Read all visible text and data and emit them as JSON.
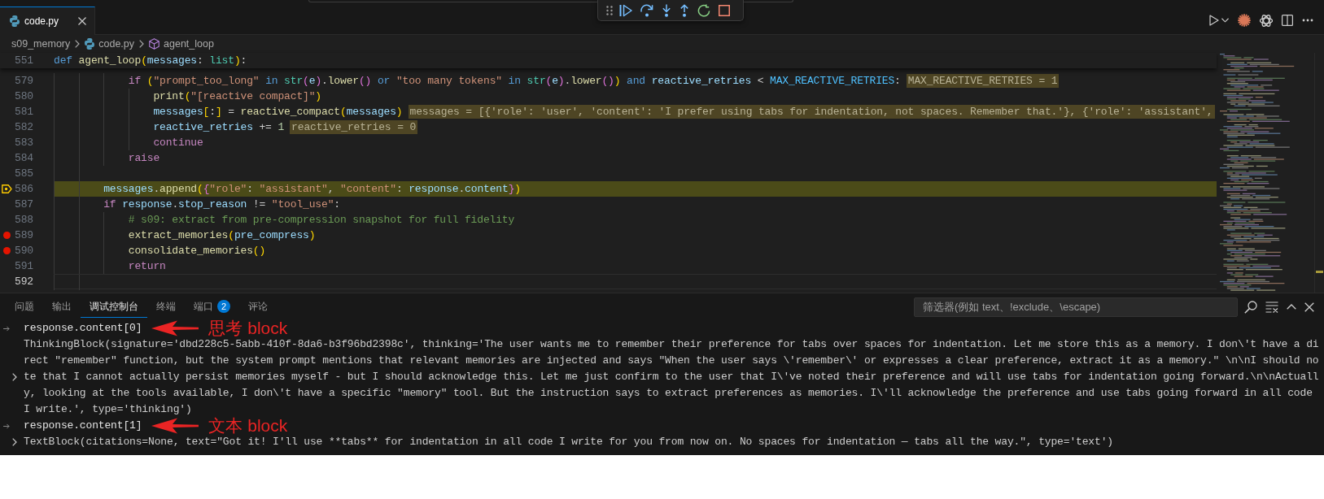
{
  "tabs": [
    {
      "label": "code.py",
      "selected": true
    }
  ],
  "breadcrumb": [
    {
      "label": "s09_memory",
      "kind": "folder"
    },
    {
      "label": "code.py",
      "kind": "file"
    },
    {
      "label": "agent_loop",
      "kind": "symbol"
    }
  ],
  "editor": {
    "sticky_line": {
      "number": "551",
      "code": [
        {
          "text": "def ",
          "kind": "keyword"
        },
        {
          "text": "agent_loop",
          "kind": "function"
        },
        {
          "text": "(",
          "kind": "bracket1"
        },
        {
          "text": "messages",
          "kind": "variable"
        },
        {
          "text": ": ",
          "kind": "plain"
        },
        {
          "text": "list",
          "kind": "type"
        },
        {
          "text": ")",
          "kind": "bracket1"
        },
        {
          "text": ":",
          "kind": "plain"
        }
      ]
    },
    "lines": [
      {
        "number": "579",
        "code": [
          {
            "text": "            if ",
            "kind": "control"
          },
          {
            "text": "(",
            "kind": "bracket1"
          },
          {
            "text": "\"prompt_too_long\"",
            "kind": "string"
          },
          {
            "text": " in ",
            "kind": "keyword"
          },
          {
            "text": "str",
            "kind": "type"
          },
          {
            "text": "(",
            "kind": "bracket2"
          },
          {
            "text": "e",
            "kind": "variable"
          },
          {
            "text": ")",
            "kind": "bracket2"
          },
          {
            "text": ".",
            "kind": "plain"
          },
          {
            "text": "lower",
            "kind": "function"
          },
          {
            "text": "()",
            "kind": "bracket2"
          },
          {
            "text": " or ",
            "kind": "keyword"
          },
          {
            "text": "\"too many tokens\"",
            "kind": "string"
          },
          {
            "text": " in ",
            "kind": "keyword"
          },
          {
            "text": "str",
            "kind": "type"
          },
          {
            "text": "(",
            "kind": "bracket2"
          },
          {
            "text": "e",
            "kind": "variable"
          },
          {
            "text": ")",
            "kind": "bracket2"
          },
          {
            "text": ".",
            "kind": "plain"
          },
          {
            "text": "lower",
            "kind": "function"
          },
          {
            "text": "()",
            "kind": "bracket2"
          },
          {
            "text": ")",
            "kind": "bracket1"
          },
          {
            "text": " and ",
            "kind": "keyword"
          },
          {
            "text": "reactive_retries",
            "kind": "variable"
          },
          {
            "text": " < ",
            "kind": "plain"
          },
          {
            "text": "MAX_REACTIVE_RETRIES",
            "kind": "constant"
          },
          {
            "text": ":",
            "kind": "plain"
          }
        ],
        "inline_value": "MAX_REACTIVE_RETRIES = 1",
        "breakpoint": false,
        "paused": false,
        "cursor": false
      },
      {
        "number": "580",
        "code": [
          {
            "text": "                print",
            "kind": "function"
          },
          {
            "text": "(",
            "kind": "bracket1"
          },
          {
            "text": "\"[reactive compact]\"",
            "kind": "string"
          },
          {
            "text": ")",
            "kind": "bracket1"
          }
        ],
        "breakpoint": false,
        "paused": false,
        "cursor": false
      },
      {
        "number": "581",
        "code": [
          {
            "text": "                messages",
            "kind": "variable"
          },
          {
            "text": "[",
            "kind": "bracket1"
          },
          {
            "text": ":",
            "kind": "plain"
          },
          {
            "text": "]",
            "kind": "bracket1"
          },
          {
            "text": " = ",
            "kind": "plain"
          },
          {
            "text": "reactive_compact",
            "kind": "function"
          },
          {
            "text": "(",
            "kind": "bracket1"
          },
          {
            "text": "messages",
            "kind": "variable"
          },
          {
            "text": ")",
            "kind": "bracket1"
          }
        ],
        "inline_value": "messages = [{'role': 'user', 'content': 'I prefer using tabs for indentation, not spaces. Remember that.'}, {'role': 'assistant',",
        "breakpoint": false,
        "paused": false,
        "cursor": false
      },
      {
        "number": "582",
        "code": [
          {
            "text": "                reactive_retries",
            "kind": "variable"
          },
          {
            "text": " += ",
            "kind": "plain"
          },
          {
            "text": "1",
            "kind": "number"
          }
        ],
        "inline_value": "reactive_retries = 0",
        "breakpoint": false,
        "paused": false,
        "cursor": false
      },
      {
        "number": "583",
        "code": [
          {
            "text": "                continue",
            "kind": "control"
          }
        ],
        "breakpoint": false,
        "paused": false,
        "cursor": false
      },
      {
        "number": "584",
        "code": [
          {
            "text": "            raise",
            "kind": "control"
          }
        ],
        "breakpoint": false,
        "paused": false,
        "cursor": false
      },
      {
        "number": "585",
        "breakpoint": false,
        "paused": false,
        "cursor": false
      },
      {
        "number": "586",
        "code": [
          {
            "text": "        messages",
            "kind": "variable"
          },
          {
            "text": ".",
            "kind": "plain"
          },
          {
            "text": "append",
            "kind": "function"
          },
          {
            "text": "(",
            "kind": "bracket1"
          },
          {
            "text": "{",
            "kind": "bracket2"
          },
          {
            "text": "\"role\"",
            "kind": "string"
          },
          {
            "text": ": ",
            "kind": "plain"
          },
          {
            "text": "\"assistant\"",
            "kind": "string"
          },
          {
            "text": ", ",
            "kind": "plain"
          },
          {
            "text": "\"content\"",
            "kind": "string"
          },
          {
            "text": ": ",
            "kind": "plain"
          },
          {
            "text": "response",
            "kind": "variable"
          },
          {
            "text": ".",
            "kind": "plain"
          },
          {
            "text": "content",
            "kind": "variable"
          },
          {
            "text": "}",
            "kind": "bracket2"
          },
          {
            "text": ")",
            "kind": "bracket1"
          }
        ],
        "breakpoint": false,
        "paused": true,
        "cursor": false
      },
      {
        "number": "587",
        "code": [
          {
            "text": "        if ",
            "kind": "control"
          },
          {
            "text": "response",
            "kind": "variable"
          },
          {
            "text": ".",
            "kind": "plain"
          },
          {
            "text": "stop_reason",
            "kind": "variable"
          },
          {
            "text": " != ",
            "kind": "plain"
          },
          {
            "text": "\"tool_use\"",
            "kind": "string"
          },
          {
            "text": ":",
            "kind": "plain"
          }
        ],
        "breakpoint": false,
        "paused": false,
        "cursor": false
      },
      {
        "number": "588",
        "code": [
          {
            "text": "            # s09: extract from pre-compression snapshot for full fidelity",
            "kind": "comment"
          }
        ],
        "breakpoint": false,
        "paused": false,
        "cursor": false
      },
      {
        "number": "589",
        "code": [
          {
            "text": "            extract_memories",
            "kind": "function"
          },
          {
            "text": "(",
            "kind": "bracket1"
          },
          {
            "text": "pre_compress",
            "kind": "variable"
          },
          {
            "text": ")",
            "kind": "bracket1"
          }
        ],
        "breakpoint": true,
        "paused": false,
        "cursor": false
      },
      {
        "number": "590",
        "code": [
          {
            "text": "            consolidate_memories",
            "kind": "function"
          },
          {
            "text": "()",
            "kind": "bracket1"
          }
        ],
        "breakpoint": true,
        "paused": false,
        "cursor": false
      },
      {
        "number": "591",
        "code": [
          {
            "text": "            return",
            "kind": "control"
          }
        ],
        "breakpoint": false,
        "paused": false,
        "cursor": false
      },
      {
        "number": "592",
        "breakpoint": false,
        "paused": false,
        "cursor": true
      }
    ]
  },
  "panel": {
    "tabs": [
      {
        "label": "问题",
        "selected": false
      },
      {
        "label": "输出",
        "selected": false
      },
      {
        "label": "调试控制台",
        "selected": true
      },
      {
        "label": "终端",
        "selected": false
      },
      {
        "label": "端口",
        "selected": false,
        "badge": "2"
      },
      {
        "label": "评论",
        "selected": false
      }
    ],
    "filter": {
      "placeholder": "筛选器(例如 text、!exclude、\\escape)"
    },
    "console": [
      {
        "kind": "input",
        "text": "response.content[0]",
        "annotation": "思考 block"
      },
      {
        "kind": "output",
        "expanded": false,
        "lines": [
          "ThinkingBlock(signature='dbd228c5-5abb-410f-8da6-b3f96bd2398c', thinking='The user wants me to remember their preference for tabs over spaces for indentation. Let me store this as a memory. I don\\'t have a di",
          "rect \"remember\" function, but the system prompt mentions that relevant memories are injected and says \"When the user says \\'remember\\' or expresses a clear preference, extract it as a memory.\" \\n\\nI should no",
          "te that I cannot actually persist memories myself - but I should acknowledge this. Let me just confirm to the user that I\\'ve noted their preference and will use tabs for indentation going forward.\\n\\nActuall",
          "y, looking at the tools available, I don\\'t have a specific \"memory\" tool. But the instruction says to extract preferences as memories. I\\'ll acknowledge the preference and use tabs going forward in all code",
          "I write.', type='thinking')"
        ]
      },
      {
        "kind": "input",
        "text": "response.content[1]",
        "annotation": "文本 block"
      },
      {
        "kind": "output",
        "expanded": false,
        "lines": [
          "TextBlock(citations=None, text=\"Got it! I'll use **tabs** for indentation in all code I write for you from now on. No spaces for indentation — tabs all the way.\", type='text')"
        ]
      }
    ]
  }
}
